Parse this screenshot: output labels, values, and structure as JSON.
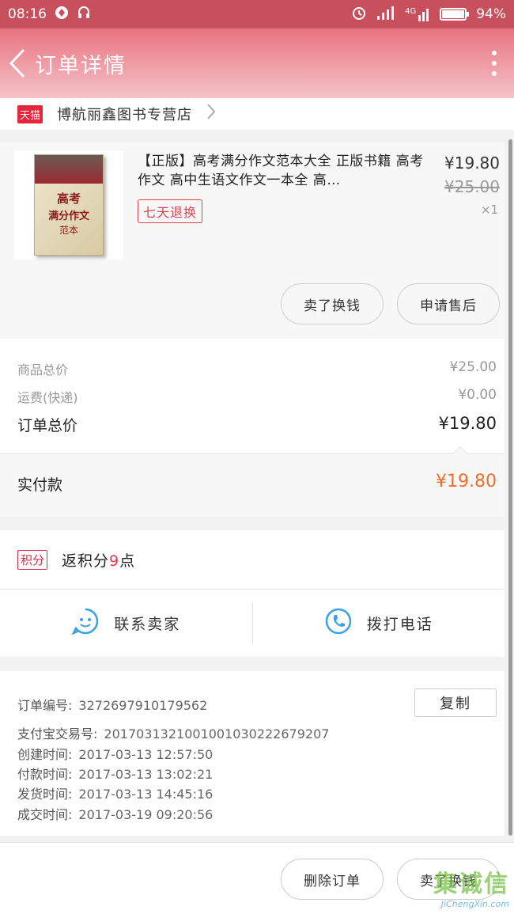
{
  "status_bar": {
    "time": "08:16",
    "network": "4G",
    "battery": "94%",
    "battery_level": 0.94
  },
  "header": {
    "title": "订单详情"
  },
  "shop": {
    "badge": "天猫",
    "name": "博航丽鑫图书专营店"
  },
  "product": {
    "title": "【正版】高考满分作文范本大全 正版书籍 高考作文 高中生语文作文一本全 高…",
    "tag": "七天退换",
    "price": "¥19.80",
    "original_price": "¥25.00",
    "quantity": "×1",
    "cover": {
      "title_line1": "高考",
      "title_line2": "满分作文",
      "title_line3": "范本"
    },
    "buttons": {
      "resell": "卖了换钱",
      "after_sale": "申请售后"
    }
  },
  "summary": {
    "goods_total_label": "商品总价",
    "goods_total_value": "¥25.00",
    "shipping_label": "运费(快递)",
    "shipping_value": "¥0.00",
    "order_total_label": "订单总价",
    "order_total_value": "¥19.80",
    "paid_label": "实付款",
    "paid_value": "¥19.80"
  },
  "points": {
    "badge": "积分",
    "text_prefix": "返积分",
    "number": "9",
    "text_suffix": "点"
  },
  "contact": {
    "seller_label": "联系卖家",
    "phone_label": "拨打电话"
  },
  "order_info": {
    "order_no_label": "订单编号:",
    "order_no": "3272697910179562",
    "copy_label": "复制",
    "alipay_label": "支付宝交易号:",
    "alipay_no": "2017031321001001030222679207",
    "created_label": "创建时间:",
    "created": "2017-03-13 12:57:50",
    "paid_label": "付款时间:",
    "paid": "2017-03-13 13:02:21",
    "shipped_label": "发货时间:",
    "shipped": "2017-03-13 14:45:16",
    "done_label": "成交时间:",
    "done": "2017-03-19 09:20:56"
  },
  "bottom_actions": {
    "delete": "删除订单",
    "resell": "卖了换钱"
  },
  "watermark": {
    "main": "集诚信",
    "sub": "JiChengXin.com"
  },
  "colors": {
    "accent": "#e0424f",
    "paid": "#f06d2a",
    "header_top": "#e8737f"
  }
}
